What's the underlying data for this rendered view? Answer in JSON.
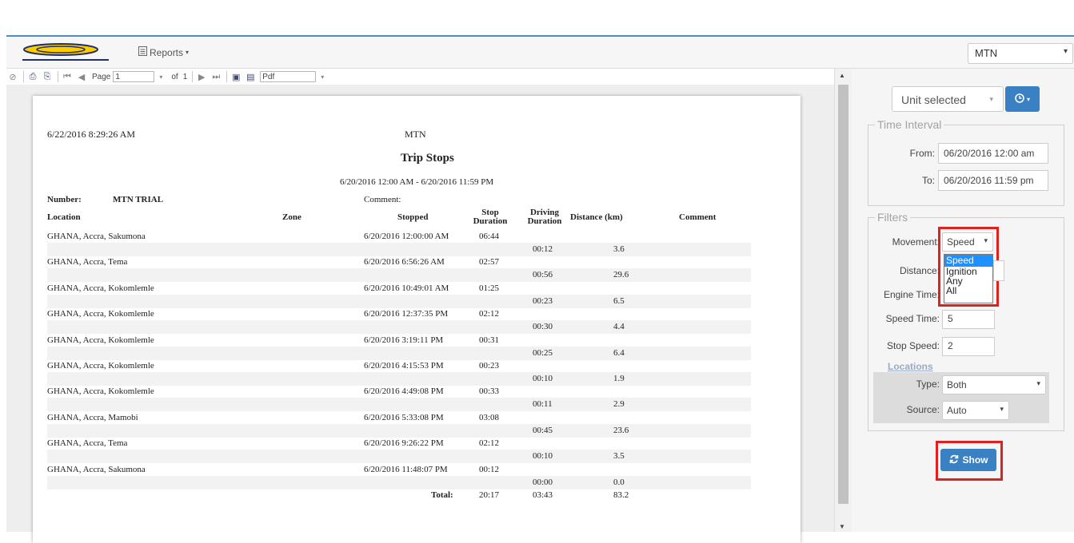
{
  "navbar": {
    "reports_label": "Reports",
    "company_selected": "MTN"
  },
  "toolbar": {
    "page_label": "Page",
    "page_value": "1",
    "of_label": "of",
    "total_pages": "1",
    "export_format": "Pdf"
  },
  "report": {
    "generated_at": "6/22/2016 8:29:26 AM",
    "company": "MTN",
    "title": "Trip Stops",
    "date_range": "6/20/2016 12:00 AM - 6/20/2016 11:59 PM",
    "number_label": "Number:",
    "number_value": "MTN TRIAL",
    "comment_label": "Comment:",
    "columns": {
      "location": "Location",
      "zone": "Zone",
      "stopped": "Stopped",
      "stop_duration_1": "Stop",
      "stop_duration_2": "Duration",
      "driving_duration_1": "Driving",
      "driving_duration_2": "Duration",
      "distance": "Distance (km)",
      "comment": "Comment"
    },
    "rows": [
      {
        "location": "GHANA, Accra, Sakumona",
        "stopped": "6/20/2016 12:00:00 AM",
        "stop_duration": "06:44",
        "driving_duration": "00:12",
        "distance": "3.6"
      },
      {
        "location": "GHANA, Accra, Tema",
        "stopped": "6/20/2016 6:56:26 AM",
        "stop_duration": "02:57",
        "driving_duration": "00:56",
        "distance": "29.6"
      },
      {
        "location": "GHANA, Accra, Kokomlemle",
        "stopped": "6/20/2016 10:49:01 AM",
        "stop_duration": "01:25",
        "driving_duration": "00:23",
        "distance": "6.5"
      },
      {
        "location": "GHANA, Accra, Kokomlemle",
        "stopped": "6/20/2016 12:37:35 PM",
        "stop_duration": "02:12",
        "driving_duration": "00:30",
        "distance": "4.4"
      },
      {
        "location": "GHANA, Accra, Kokomlemle",
        "stopped": "6/20/2016 3:19:11 PM",
        "stop_duration": "00:31",
        "driving_duration": "00:25",
        "distance": "6.4"
      },
      {
        "location": "GHANA, Accra, Kokomlemle",
        "stopped": "6/20/2016 4:15:53 PM",
        "stop_duration": "00:23",
        "driving_duration": "00:10",
        "distance": "1.9"
      },
      {
        "location": "GHANA, Accra, Kokomlemle",
        "stopped": "6/20/2016 4:49:08 PM",
        "stop_duration": "00:33",
        "driving_duration": "00:11",
        "distance": "2.9"
      },
      {
        "location": "GHANA, Accra, Mamobi",
        "stopped": "6/20/2016 5:33:08 PM",
        "stop_duration": "03:08",
        "driving_duration": "00:45",
        "distance": "23.6"
      },
      {
        "location": "GHANA, Accra, Tema",
        "stopped": "6/20/2016 9:26:22 PM",
        "stop_duration": "02:12",
        "driving_duration": "00:10",
        "distance": "3.5"
      },
      {
        "location": "GHANA, Accra, Sakumona",
        "stopped": "6/20/2016 11:48:07 PM",
        "stop_duration": "00:12",
        "driving_duration": "00:00",
        "distance": "0.0"
      }
    ],
    "total_label": "Total:",
    "total_stop_duration": "20:17",
    "total_driving_duration": "03:43",
    "total_distance": "83.2"
  },
  "panel": {
    "unit_select": "Unit selected",
    "time_interval": {
      "legend": "Time Interval",
      "from_label": "From:",
      "from_value": "06/20/2016 12:00 am",
      "to_label": "To:",
      "to_value": "06/20/2016 11:59 pm"
    },
    "filters": {
      "legend": "Filters",
      "movement_label": "Movement:",
      "movement_value": "Speed",
      "movement_options": [
        "Speed",
        "Ignition",
        "Any",
        "All"
      ],
      "distance_label": "Distance:",
      "engine_time_label": "Engine Time:",
      "speed_time_label": "Speed Time:",
      "speed_time_value": "5",
      "stop_speed_label": "Stop Speed:",
      "stop_speed_value": "2",
      "locations_label": "Locations",
      "type_label": "Type:",
      "type_value": "Both",
      "source_label": "Source:",
      "source_value": "Auto"
    },
    "show_label": "Show"
  },
  "colors": {
    "accent": "#3a81c4",
    "highlight": "#e0201e",
    "brand_yellow": "#ffcc00"
  }
}
